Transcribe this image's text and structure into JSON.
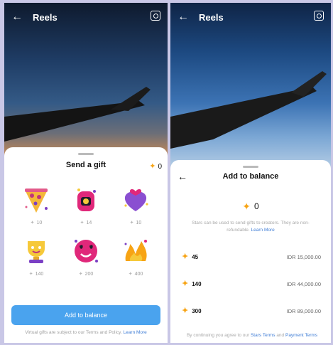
{
  "left_screen": {
    "header": {
      "title": "Reels"
    },
    "sheet": {
      "title": "Send a gift",
      "balance": "0",
      "gifts": [
        {
          "icon": "pizza-sticker",
          "price": "10"
        },
        {
          "icon": "heart-hands-sticker",
          "price": "14"
        },
        {
          "icon": "heart-sticker",
          "price": "10"
        },
        {
          "icon": "trophy-sticker",
          "price": "140"
        },
        {
          "icon": "heart-eyes-sticker",
          "price": "200"
        },
        {
          "icon": "fire-sticker",
          "price": "400"
        }
      ],
      "cta_label": "Add to balance",
      "legal_text": "Virtual gifts are subject to our Terms and Policy. ",
      "legal_link": "Learn More"
    }
  },
  "right_screen": {
    "header": {
      "title": "Reels"
    },
    "sheet": {
      "title": "Add to balance",
      "balance": "0",
      "note_text": "Stars can be used to send gifts to creators. They are non-refundable. ",
      "note_link": "Learn More",
      "packages": [
        {
          "amount": "45",
          "price": "IDR 15,000.00"
        },
        {
          "amount": "140",
          "price": "IDR 44,000.00"
        },
        {
          "amount": "300",
          "price": "IDR 89,000.00"
        }
      ],
      "legal_text": "By continuing you agree to our ",
      "legal_link_1": "Stars Terms",
      "legal_and": " and ",
      "legal_link_2": "Payment Terms"
    }
  },
  "colors": {
    "accent": "#4aa3ee",
    "star": "#f7a415",
    "link": "#3f7dd6",
    "page_bg": "#c9c7e6"
  }
}
